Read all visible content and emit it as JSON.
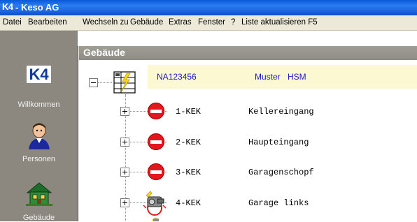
{
  "window": {
    "logo": "K4",
    "title": "- Keso AG"
  },
  "menu": {
    "items": [
      "Datei",
      "Bearbeiten",
      "Wechseln zu",
      "Gebäude",
      "Extras",
      "Fenster",
      "?",
      "Liste aktualisieren F5"
    ]
  },
  "sidebar": {
    "logo": "K4",
    "items": [
      {
        "label": "Willkommen",
        "icon": "k4-logo-icon"
      },
      {
        "label": "Personen",
        "icon": "person-icon"
      },
      {
        "label": "Gebäude",
        "icon": "building-icon"
      }
    ]
  },
  "header": {
    "title": "Gebäude"
  },
  "tree": {
    "root": {
      "id": "NA123456",
      "name": "Muster",
      "suffix": "HSM",
      "icon": "door-system-icon"
    },
    "children": [
      {
        "id": "1-KEK",
        "name": "Kellereingang",
        "icon": "no-entry-icon"
      },
      {
        "id": "2-KEK",
        "name": "Haupteingang",
        "icon": "no-entry-icon"
      },
      {
        "id": "3-KEK",
        "name": "Garagenschopf",
        "icon": "no-entry-icon"
      },
      {
        "id": "4-KEK",
        "name": "Garage links",
        "icon": "cylinder-lock-icon"
      }
    ]
  },
  "colors": {
    "titlebar": "#1b63dd",
    "menubar": "#ece9d8",
    "sidebar": "#8c8880",
    "root_highlight": "#fcf8d2",
    "root_text": "#1a1ac8",
    "no_entry_red": "#e3171e"
  }
}
